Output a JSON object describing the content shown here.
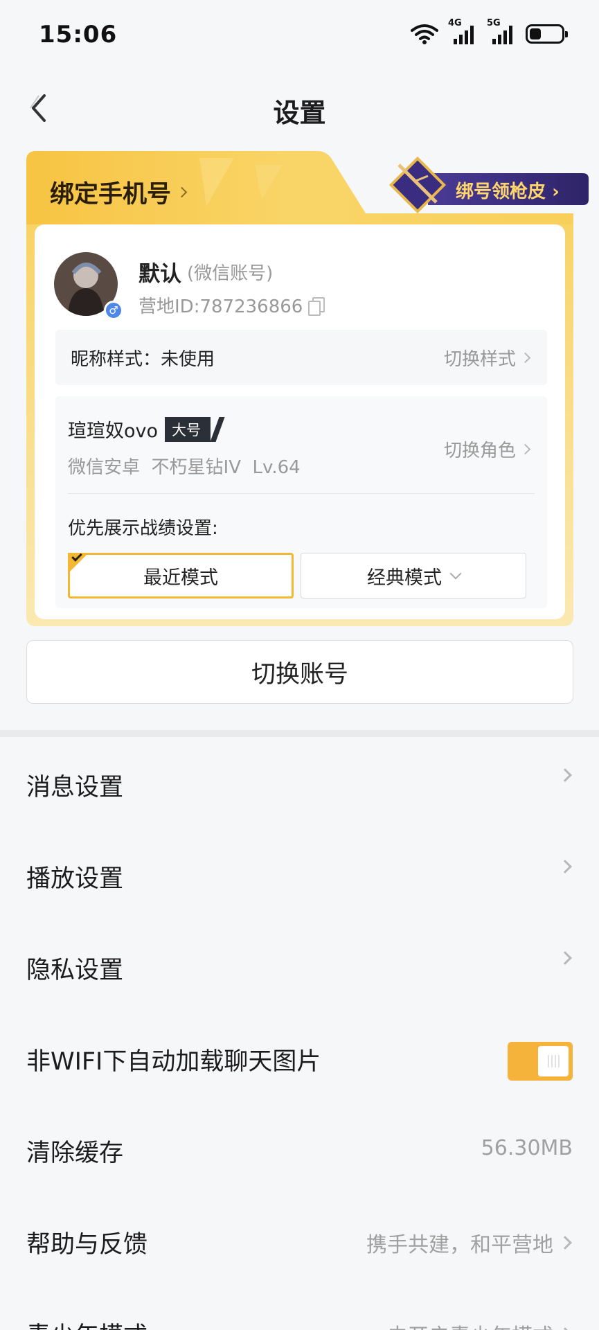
{
  "status_bar": {
    "time": "15:06",
    "signal_1_label": "4G",
    "signal_2_label": "5G",
    "icons": [
      "wifi-icon",
      "signal-icon",
      "battery-icon"
    ]
  },
  "header": {
    "title": "设置",
    "back_icon": "chevron-left-icon"
  },
  "account_card": {
    "bind_phone_label": "绑定手机号",
    "bind_reward_label": "绑号领枪皮",
    "user": {
      "name": "默认",
      "account_type": "(微信账号)",
      "camp_id": "营地ID:787236866",
      "gender": "♂"
    },
    "nickname_style": {
      "label": "昵称样式：未使用",
      "action": "切换样式"
    },
    "role": {
      "name": "瑄瑄奴ovo",
      "tag": "大号",
      "detail": "微信安卓  不朽星钻IV  Lv.64",
      "action": "切换角色"
    },
    "record_pref": {
      "label": "优先展示战绩设置:",
      "options": [
        "最近模式",
        "经典模式"
      ],
      "selected": "最近模式"
    }
  },
  "switch_account_label": "切换账号",
  "settings": [
    {
      "label": "消息设置",
      "value": ""
    },
    {
      "label": "播放设置",
      "value": ""
    },
    {
      "label": "隐私设置",
      "value": ""
    },
    {
      "label": "非WIFI下自动加载聊天图片",
      "value": "",
      "toggle_on": true
    },
    {
      "label": "清除缓存",
      "value": "56.30MB"
    },
    {
      "label": "帮助与反馈",
      "value": "携手共建，和平营地"
    },
    {
      "label": "青少年模式",
      "value": "未开启青少年模式"
    }
  ],
  "colors": {
    "accent": "#f5b33b",
    "card_gold": "#f7c84a",
    "badge_purple": "#3b2d78",
    "badge_text": "#ffd66b"
  }
}
